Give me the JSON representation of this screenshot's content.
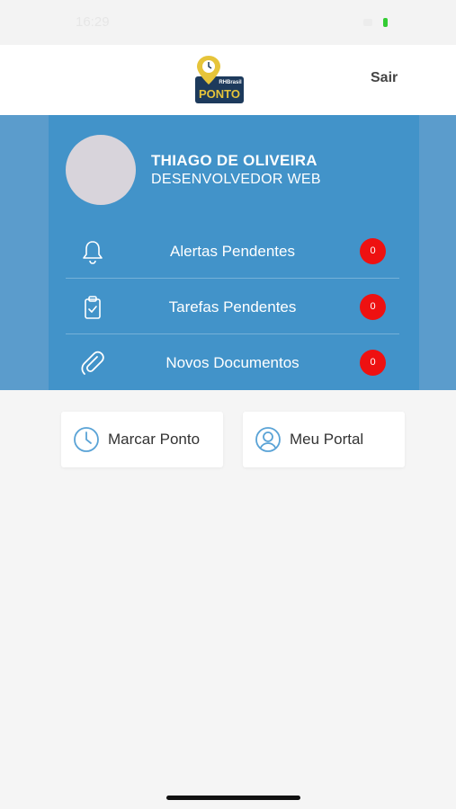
{
  "status_bar": {
    "time": "16:29"
  },
  "header": {
    "logo_brand": "RHBrasil",
    "logo_text": "PONTO",
    "logout_label": "Sair"
  },
  "profile": {
    "name": "THIAGO DE OLIVEIRA",
    "role": "DESENVOLVEDOR WEB"
  },
  "menu": [
    {
      "label": "Alertas Pendentes",
      "icon": "bell-icon",
      "count": "0"
    },
    {
      "label": "Tarefas Pendentes",
      "icon": "clipboard-icon",
      "count": "0"
    },
    {
      "label": "Novos Documentos",
      "icon": "paperclip-icon",
      "count": "0"
    }
  ],
  "actions": [
    {
      "label": "Marcar Ponto",
      "icon": "clock-icon"
    },
    {
      "label": "Meu Portal",
      "icon": "user-icon"
    }
  ],
  "colors": {
    "panel": "#4293c9",
    "panel_side": "#5b9ccc",
    "badge": "#ee1111",
    "card_icon": "#5aa3d6",
    "logo_pin": "#e6c43a",
    "logo_plate": "#1d3a5c"
  }
}
